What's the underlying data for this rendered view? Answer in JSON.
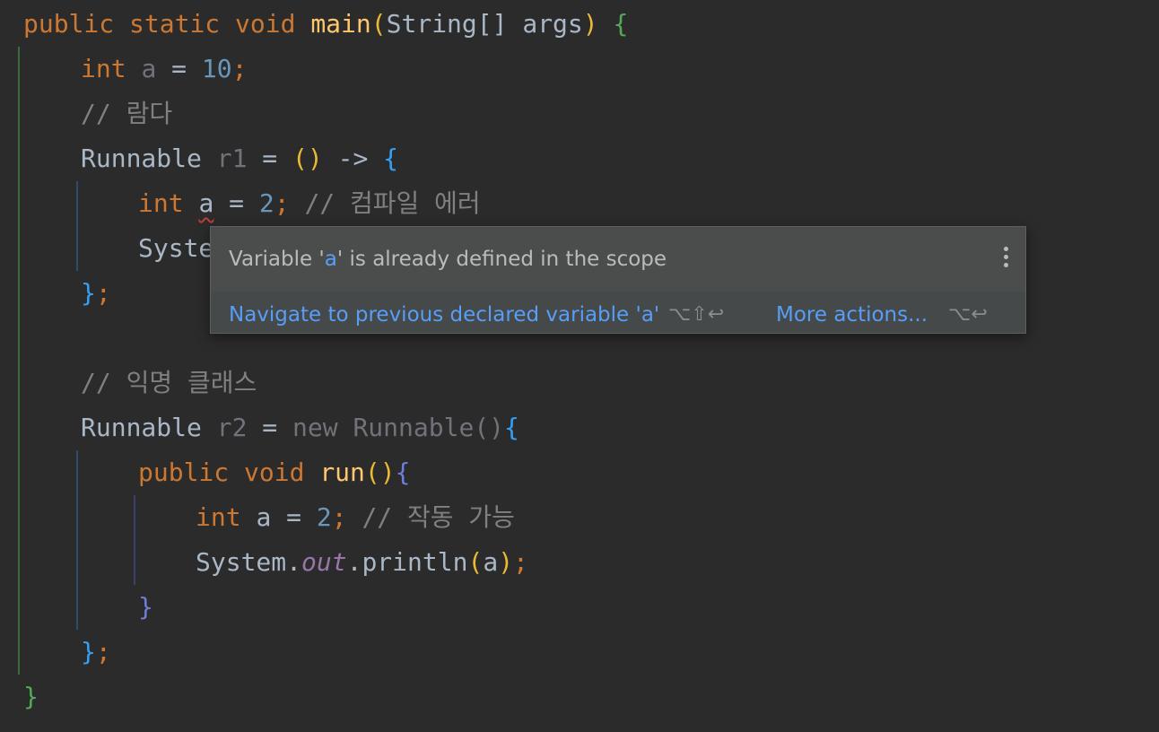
{
  "code": {
    "main_sig": {
      "public": "public",
      "static": "static",
      "void": "void",
      "name": "main",
      "open_paren": "(",
      "params": "String[] args",
      "close_paren": ")",
      "brace": "{"
    },
    "int_a": {
      "type": "int",
      "name": "a",
      "eq": "=",
      "value": "10",
      "semi": ";"
    },
    "comment_lambda": "// 람다",
    "r1_decl": {
      "type": "Runnable",
      "name": "r1",
      "eq": "=",
      "parens": "()",
      "arrow": "->",
      "brace": "{"
    },
    "r1_int_a": {
      "type": "int",
      "name": "a",
      "eq": "=",
      "value": "2",
      "semi": ";",
      "comment": "// 컴파일 에러"
    },
    "r1_println_partial": "Syste",
    "r1_close": {
      "brace": "}",
      "semi": ";"
    },
    "comment_anon": "// 익명 클래스",
    "r2_decl": {
      "type": "Runnable",
      "name": "r2",
      "eq": "=",
      "new_kw": "new",
      "ctor": "Runnable",
      "parens": "()",
      "brace": "{"
    },
    "run_sig": {
      "public": "public",
      "void": "void",
      "name": "run",
      "parens": "()",
      "brace": "{"
    },
    "run_int_a": {
      "type": "int",
      "name": "a",
      "eq": "=",
      "value": "2",
      "semi": ";",
      "comment": "// 작동 가능"
    },
    "run_println": {
      "cls": "System",
      "dot1": ".",
      "field": "out",
      "dot2": ".",
      "method": "println",
      "open": "(",
      "arg": "a",
      "close": ")",
      "semi": ";"
    },
    "run_close": "}",
    "r2_close": {
      "brace": "}",
      "semi": ";"
    },
    "main_close": "}"
  },
  "popup": {
    "message_prefix": "Variable '",
    "message_var": "a",
    "message_suffix": "' is already defined in the scope",
    "menu_icon": "kebab-vertical-icon",
    "action_navigate": "Navigate to previous declared variable 'a'",
    "shortcut_navigate": "⌥⇧↩",
    "action_more": "More actions...",
    "shortcut_more": "⌥↩"
  },
  "colors": {
    "background": "#2b2b2b",
    "keyword": "#cc7832",
    "function": "#ffc66d",
    "number": "#6897bb",
    "comment": "#808080",
    "error_underline": "#bc3f3c",
    "popup_bg": "#4b4d4d",
    "link": "#589df6"
  }
}
